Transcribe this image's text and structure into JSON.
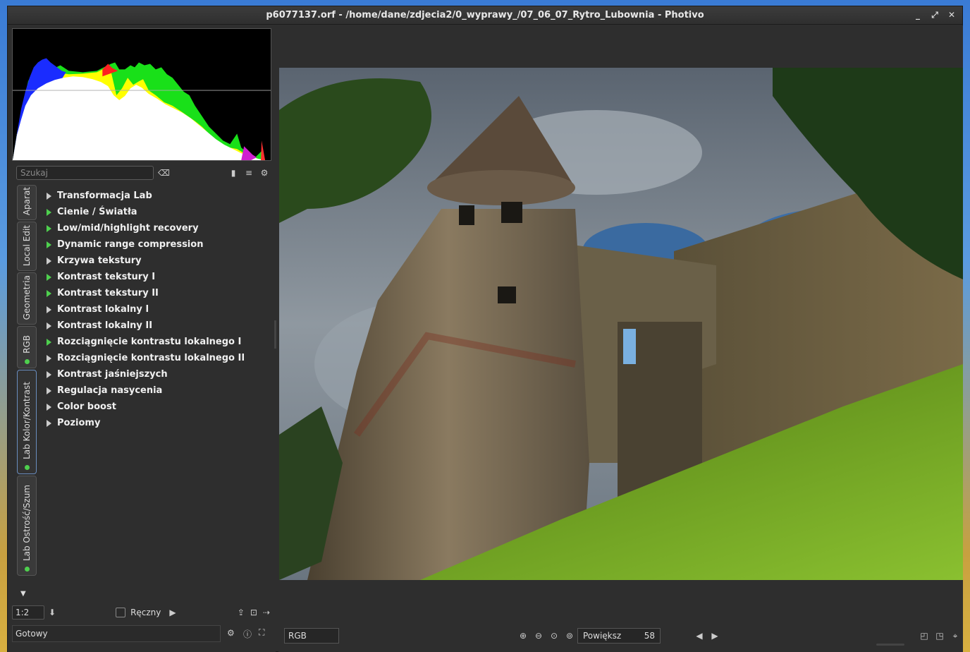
{
  "window": {
    "title": "p6077137.orf - /home/dane/zdjecia2/0_wyprawy_/07_06_07_Rytro_Lubownia - Photivo",
    "controls": {
      "minimize": "_",
      "maximize": "⤢",
      "close": "✕"
    }
  },
  "histogram": {
    "icon": "histogram"
  },
  "search": {
    "placeholder": "Szukaj",
    "clear_icon": "⌫",
    "bookmark_icon": "▮",
    "list_icon": "≡",
    "settings_icon": "⚙"
  },
  "tabs": [
    {
      "label": "Aparat",
      "dot": false,
      "active": false
    },
    {
      "label": "Local Edit",
      "dot": false,
      "active": false
    },
    {
      "label": "Geometria",
      "dot": false,
      "active": false
    },
    {
      "label": "RGB",
      "dot": true,
      "active": false
    },
    {
      "label": "Lab Kolor/Kontrast",
      "dot": true,
      "active": true
    },
    {
      "label": "Lab Ostrość/Szum",
      "dot": true,
      "active": false
    }
  ],
  "filters": [
    {
      "label": "Transformacja Lab",
      "active": false
    },
    {
      "label": "Cienie / Światła",
      "active": true
    },
    {
      "label": "Low/mid/highlight recovery",
      "active": true
    },
    {
      "label": "Dynamic range compression",
      "active": true
    },
    {
      "label": "Krzywa tekstury",
      "active": false
    },
    {
      "label": "Kontrast tekstury I",
      "active": true
    },
    {
      "label": "Kontrast tekstury II",
      "active": true
    },
    {
      "label": "Kontrast lokalny I",
      "active": false
    },
    {
      "label": "Kontrast lokalny II",
      "active": false
    },
    {
      "label": "Rozciągnięcie kontrastu lokalnego I",
      "active": true
    },
    {
      "label": "Rozciągnięcie kontrastu lokalnego II",
      "active": false
    },
    {
      "label": "Kontrast jaśniejszych",
      "active": false
    },
    {
      "label": "Regulacja nasycenia",
      "active": false
    },
    {
      "label": "Color boost",
      "active": false
    },
    {
      "label": "Poziomy",
      "active": false
    }
  ],
  "pipe": {
    "zoom_value": "1:2",
    "manual_label": "Ręczny",
    "manual_checked": false
  },
  "status": {
    "text": "Gotowy"
  },
  "viewer": {
    "colorspace": "RGB",
    "zoom_label": "Powiększ",
    "zoom_value": "58"
  }
}
